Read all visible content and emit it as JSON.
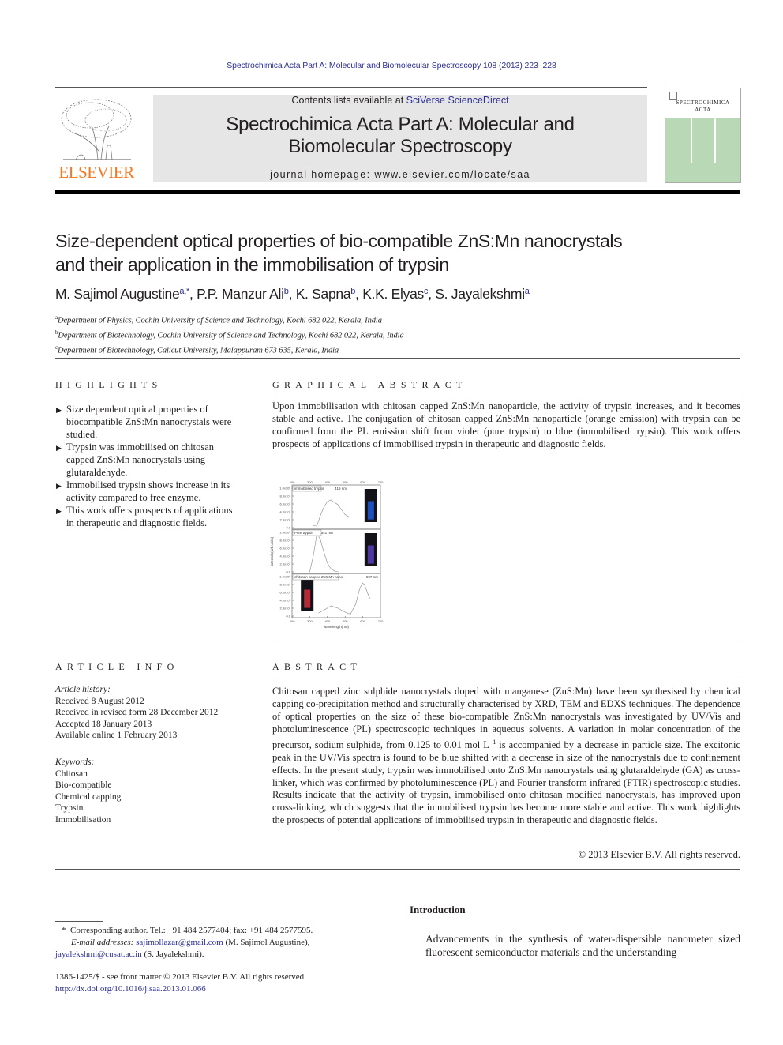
{
  "running_head": "Spectrochimica Acta Part A: Molecular and Biomolecular Spectroscopy 108 (2013) 223–228",
  "publisher": {
    "name": "ELSEVIER",
    "brand_color": "#f47920"
  },
  "banner": {
    "contents_prefix": "Contents lists available at ",
    "contents_link": "SciVerse ScienceDirect",
    "journal_title_line1": "Spectrochimica Acta Part A: Molecular and",
    "journal_title_line2": "Biomolecular Spectroscopy",
    "homepage": "journal homepage: www.elsevier.com/locate/saa"
  },
  "cover": {
    "title_line1": "SPECTROCHIMICA",
    "title_line2": "ACTA",
    "color": "#b9d9b6"
  },
  "article": {
    "title_line1": "Size-dependent optical properties of bio-compatible ZnS:Mn nanocrystals",
    "title_line2": "and their application in the immobilisation of trypsin",
    "authors": [
      {
        "name": "M. Sajimol Augustine",
        "sup": "a,*"
      },
      {
        "name": "P.P. Manzur Ali",
        "sup": "b"
      },
      {
        "name": "K. Sapna",
        "sup": "b"
      },
      {
        "name": "K.K. Elyas",
        "sup": "c"
      },
      {
        "name": "S. Jayalekshmi",
        "sup": "a"
      }
    ],
    "affiliations": [
      {
        "sup": "a",
        "text": "Department of Physics, Cochin University of Science and Technology, Kochi 682 022, Kerala, India"
      },
      {
        "sup": "b",
        "text": "Department of Biotechnology, Cochin University of Science and Technology, Kochi 682 022, Kerala, India"
      },
      {
        "sup": "c",
        "text": "Department of Biotechnology, Calicut University, Malappuram 673 635, Kerala, India"
      }
    ]
  },
  "highlights": {
    "heading": "HIGHLIGHTS",
    "bullet": "▶",
    "items": [
      "Size dependent optical properties of biocompatible ZnS:Mn nanocrystals were studied.",
      "Trypsin was immobilised on chitosan capped ZnS:Mn nanocrystals using glutaraldehyde.",
      "Immobilised trypsin shows increase in its activity compared to free enzyme.",
      "This work offers prospects of applications in therapeutic and diagnostic fields."
    ]
  },
  "graphical_abstract": {
    "heading": "GRAPHICAL ABSTRACT",
    "text": "Upon immobilisation with chitosan capped ZnS:Mn nanoparticle, the activity of trypsin increases, and it becomes stable and active. The conjugation of chitosan capped ZnS:Mn nanoparticle (orange emission) with trypsin can be confirmed from the PL emission shift from violet (pure trypsin) to blue (immobilised trypsin). This work offers prospects of applications of immobilised trypsin in therapeutic and diagnostic fields."
  },
  "chart_data": {
    "type": "line",
    "title": "",
    "xlabel": "wavelength(nm)",
    "ylabel": "intensity(arb.units)",
    "xlim": [
      200,
      700
    ],
    "x_ticks": [
      "200",
      "300",
      "400",
      "500",
      "600",
      "700"
    ],
    "ylim": [
      0,
      100000000
    ],
    "y_ticks": [
      "0.0",
      "2.0x10⁷",
      "4.0x10⁷",
      "6.0x10⁷",
      "8.0x10⁷",
      "1.0x10⁸"
    ],
    "grid": false,
    "panels": [
      {
        "label": "immobilised trypsin",
        "peak_label": "419 nm",
        "inset_color": "#1e5bd8",
        "x": [
          320,
          340,
          360,
          380,
          400,
          419,
          440,
          460,
          480,
          500,
          520
        ],
        "y": [
          5000000,
          4000000,
          30000000,
          52000000,
          66000000,
          70000000,
          64000000,
          58000000,
          45000000,
          33000000,
          28000000
        ]
      },
      {
        "label": "Pure trypsin",
        "peak_label": "341 nm",
        "inset_color": "#5a3fb8",
        "x": [
          300,
          320,
          341,
          360,
          380,
          400,
          420,
          440,
          460
        ],
        "y": [
          0,
          40000000,
          98000000,
          82000000,
          50000000,
          22000000,
          8000000,
          2000000,
          0
        ]
      },
      {
        "label": "chitosan capped ZnS:Mn nano",
        "peak_label": "597 nm",
        "inset_color": "#d0303c",
        "x": [
          350,
          380,
          420,
          460,
          500,
          530,
          560,
          580,
          597,
          610,
          630,
          640
        ],
        "y": [
          8000000,
          15000000,
          26000000,
          20000000,
          10000000,
          5000000,
          30000000,
          65000000,
          84000000,
          80000000,
          55000000,
          45000000
        ]
      }
    ]
  },
  "article_info": {
    "heading": "ARTICLE INFO",
    "history_label": "Article history:",
    "history": [
      "Received 8 August 2012",
      "Received in revised form 28 December 2012",
      "Accepted 18 January 2013",
      "Available online 1 February 2013"
    ],
    "keywords_label": "Keywords:",
    "keywords": [
      "Chitosan",
      "Bio-compatible",
      "Chemical capping",
      "Trypsin",
      "Immobilisation"
    ]
  },
  "abstract": {
    "heading": "ABSTRACT",
    "text_before_unit": "Chitosan capped zinc sulphide nanocrystals doped with manganese (ZnS:Mn) have been synthesised by chemical capping co-precipitation method and structurally characterised by XRD, TEM and EDXS techniques. The dependence of optical properties on the size of these bio-compatible ZnS:Mn nanocrystals was investigated by UV/Vis and photoluminescence (PL) spectroscopic techniques in aqueous solvents. A variation in molar concentration of the precursor, sodium sulphide, from 0.125 to 0.01 mol L",
    "unit_sup": "−1",
    "text_after_unit": " is accompanied by a decrease in particle size. The excitonic peak in the UV/Vis spectra is found to be blue shifted with a decrease in size of the nanocrystals due to confinement effects. In the present study, trypsin was immobilised onto ZnS:Mn nanocrystals using glutaraldehyde (GA) as cross-linker, which was confirmed by photoluminescence (PL) and Fourier transform infrared (FTIR) spectroscopic studies. Results indicate that the activity of trypsin, immobilised onto chitosan modified nanocrystals, has improved upon cross-linking, which suggests that the immobilised trypsin has become more stable and active. This work highlights the prospects of potential applications of immobilised trypsin in therapeutic and diagnostic fields.",
    "copyright": "© 2013 Elsevier B.V. All rights reserved."
  },
  "footnotes": {
    "corresponding": "Corresponding author. Tel.: +91 484 2577404; fax: +91 484 2577595.",
    "corresponding_mark": "*",
    "email_label": "E-mail addresses: ",
    "email1": "sajimollazar@gmail.com",
    "email1_owner": " (M. Sajimol Augustine), ",
    "email2": "jayalekshmi@cusat.ac.in",
    "email2_owner": " (S. Jayalekshmi).",
    "issn": "1386-1425/$ - see front matter © 2013 Elsevier B.V. All rights reserved.",
    "doi": "http://dx.doi.org/10.1016/j.saa.2013.01.066"
  },
  "introduction": {
    "heading": "Introduction",
    "text": "Advancements in the synthesis of water-dispersible nanometer sized fluorescent semiconductor materials and the understanding"
  }
}
